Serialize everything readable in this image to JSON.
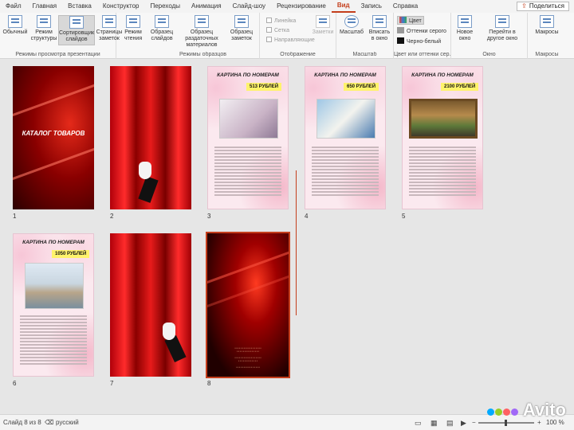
{
  "menu": {
    "items": [
      "Файл",
      "Главная",
      "Вставка",
      "Конструктор",
      "Переходы",
      "Анимация",
      "Слайд-шоу",
      "Рецензирование",
      "Вид",
      "Запись",
      "Справка"
    ],
    "active": "Вид",
    "share_label": "Поделиться"
  },
  "ribbon": {
    "groups": {
      "view_modes": "Режимы просмотра презентации",
      "master_views": "Режимы образцов",
      "show": "Отображение",
      "zoom": "Масштаб",
      "color": "Цвет или оттенки сер...",
      "window": "Окно",
      "macros": "Макросы"
    },
    "buttons": {
      "normal": "Обычный",
      "outline": "Режим структуры",
      "sorter": "Сортировщик слайдов",
      "notes_page": "Страницы заметок",
      "reading": "Режим чтения",
      "slide_master": "Образец слайдов",
      "handout_master": "Образец раздаточных материалов",
      "notes_master": "Образец заметок",
      "notes": "Заметки",
      "zoom": "Масштаб",
      "fit": "Вписать в окно",
      "new_window": "Новое окно",
      "switch_windows": "Перейти в другое окно",
      "macros": "Макросы"
    },
    "checkboxes": [
      "Линейка",
      "Сетка",
      "Направляющие"
    ],
    "color_options": [
      "Цвет",
      "Оттенки серого",
      "Черно-белый"
    ],
    "color_selected": "Цвет"
  },
  "slides": [
    {
      "num": "1",
      "kind": "catalog",
      "text": "КАТАЛОГ ТОВАРОВ"
    },
    {
      "num": "2",
      "kind": "curtain"
    },
    {
      "num": "3",
      "kind": "product",
      "title": "КАРТИНА ПО НОМЕРАМ",
      "price": "513 РУБЛЕЙ"
    },
    {
      "num": "4",
      "kind": "product",
      "title": "КАРТИНА ПО НОМЕРАМ",
      "price": "650 РУБЛЕЙ"
    },
    {
      "num": "5",
      "kind": "product",
      "title": "КАРТИНА ПО НОМЕРАМ",
      "price": "2100 РУБЛЕЙ"
    },
    {
      "num": "6",
      "kind": "product",
      "title": "КАРТИНА ПО НОМЕРАМ",
      "price": "1050 РУБЛЕЙ"
    },
    {
      "num": "7",
      "kind": "curtain"
    },
    {
      "num": "8",
      "kind": "contacts"
    }
  ],
  "status": {
    "slide_info": "Слайд 8 из 8",
    "language": "русский",
    "zoom": "100 %"
  },
  "watermark": "Avito"
}
